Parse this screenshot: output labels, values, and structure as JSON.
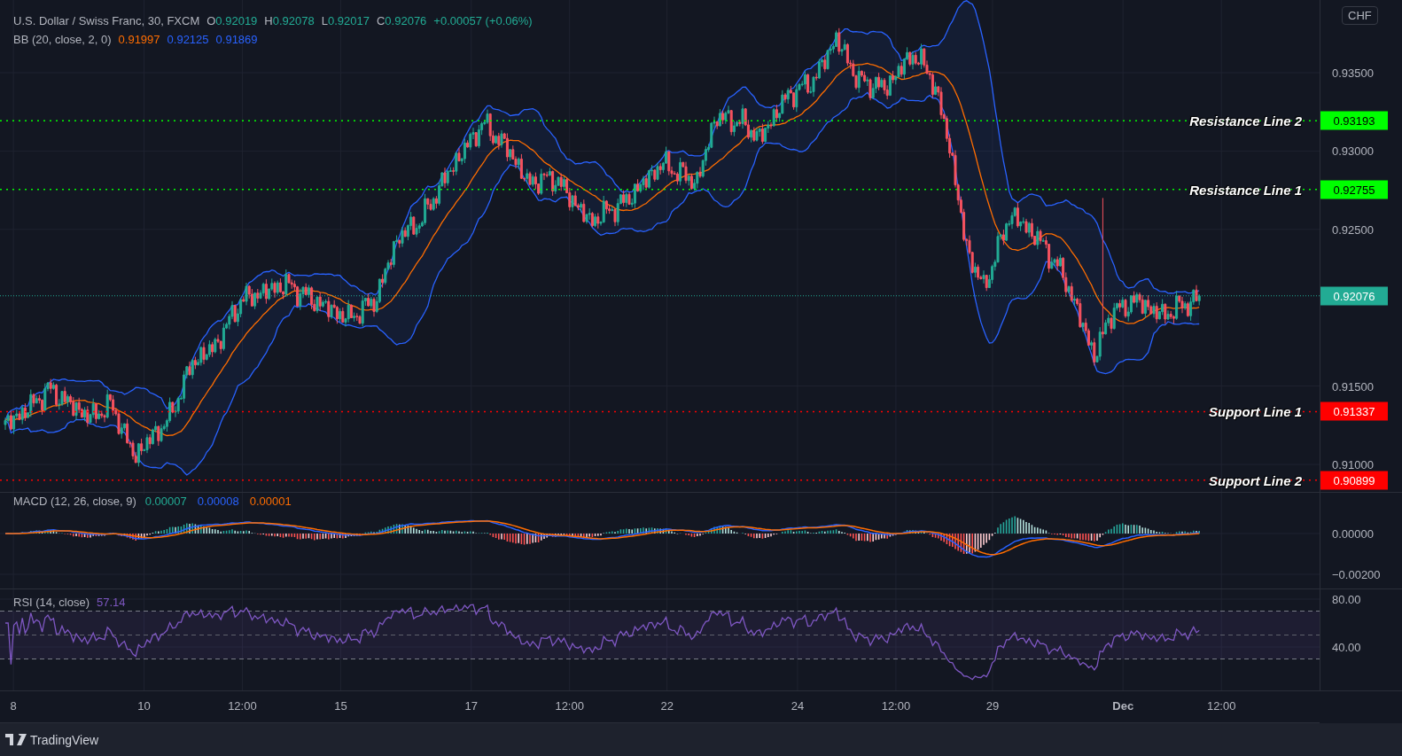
{
  "legend": {
    "symbol": "U.S. Dollar / Swiss Franc, 30, FXCM",
    "ohlc": [
      {
        "key": "O",
        "value": "0.92019"
      },
      {
        "key": "H",
        "value": "0.92078"
      },
      {
        "key": "L",
        "value": "0.92017"
      },
      {
        "key": "C",
        "value": "0.92076"
      }
    ],
    "change": "+0.00057 (+0.06%)"
  },
  "bb": {
    "name": "BB (20, close, 2, 0)",
    "values": [
      {
        "text": "0.91997",
        "color": "#ff6d00"
      },
      {
        "text": "0.92125",
        "color": "#2962ff"
      },
      {
        "text": "0.91869",
        "color": "#2962ff"
      }
    ]
  },
  "currency": "CHF",
  "price_ticks": [
    "0.93500",
    "0.93000",
    "0.92500",
    "0.91500",
    "0.91000"
  ],
  "last_price": "0.92076",
  "levels": [
    {
      "label": "Resistance Line 2",
      "price": "0.93193",
      "kind": "resistance"
    },
    {
      "label": "Resistance Line 1",
      "price": "0.92755",
      "kind": "resistance"
    },
    {
      "label": "Support Line 1",
      "price": "0.91337",
      "kind": "support"
    },
    {
      "label": "Support Line 2",
      "price": "0.90899",
      "kind": "support"
    }
  ],
  "macd": {
    "name": "MACD (12, 26, close, 9)",
    "values": [
      {
        "text": "0.00007",
        "color": "#22ab94"
      },
      {
        "text": "0.00008",
        "color": "#2962ff"
      },
      {
        "text": "0.00001",
        "color": "#ff6d00"
      }
    ],
    "ticks": [
      "0.00000",
      "−0.00200"
    ]
  },
  "rsi": {
    "name": "RSI (14, close)",
    "value": "57.14",
    "ticks": [
      "80.00",
      "40.00"
    ]
  },
  "time_axis": [
    {
      "label": "8",
      "bold": false
    },
    {
      "label": "10",
      "bold": false
    },
    {
      "label": "12:00",
      "bold": false
    },
    {
      "label": "15",
      "bold": false
    },
    {
      "label": "17",
      "bold": false
    },
    {
      "label": "12:00",
      "bold": false
    },
    {
      "label": "22",
      "bold": false
    },
    {
      "label": "24",
      "bold": false
    },
    {
      "label": "12:00",
      "bold": false
    },
    {
      "label": "29",
      "bold": false
    },
    {
      "label": "Dec",
      "bold": true
    },
    {
      "label": "12:00",
      "bold": false
    }
  ],
  "footer": {
    "brand": "TradingView"
  }
}
